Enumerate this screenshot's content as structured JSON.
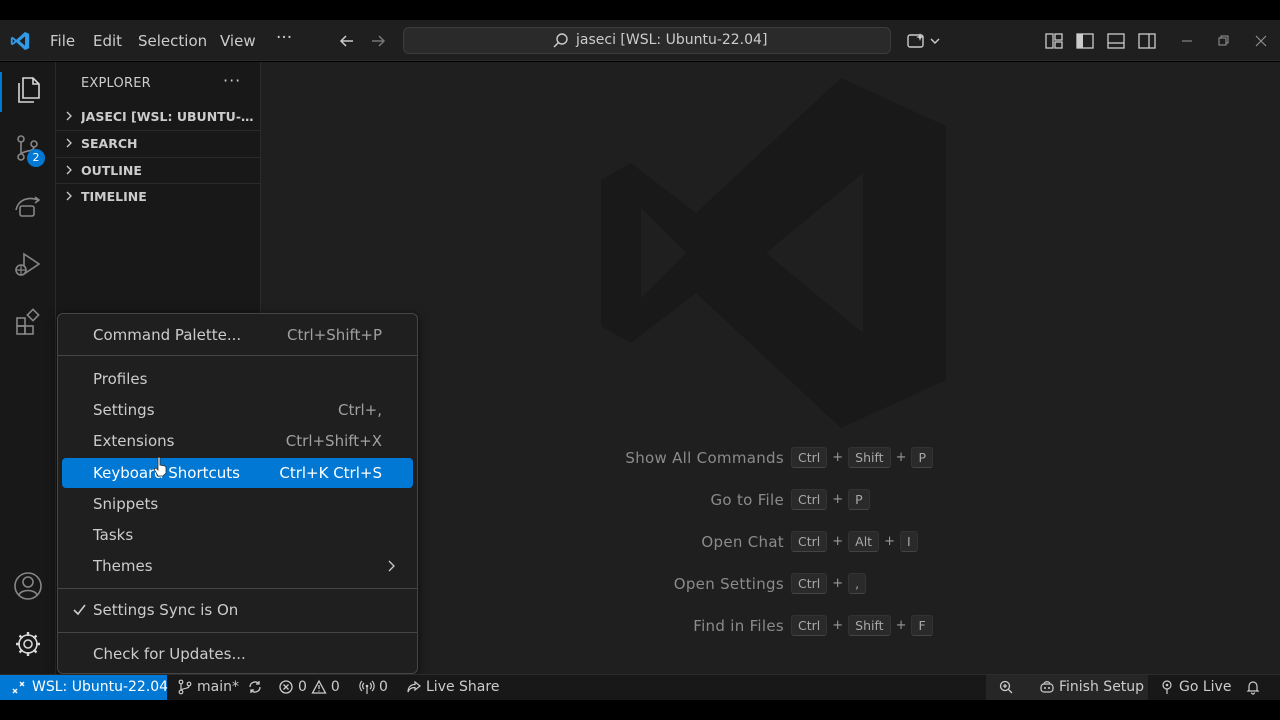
{
  "titlebar": {
    "menus": [
      "File",
      "Edit",
      "Selection",
      "View"
    ],
    "more": "···",
    "search_text": "jaseci [WSL: Ubuntu-22.04]"
  },
  "activity": {
    "source_control_badge": "2"
  },
  "sidebar": {
    "title": "EXPLORER",
    "more": "···",
    "sections": [
      "JASECI [WSL: UBUNTU-22.04]",
      "SEARCH",
      "OUTLINE",
      "TIMELINE"
    ]
  },
  "editor": {
    "hints": [
      {
        "label": "Show All Commands",
        "keys": [
          "Ctrl",
          "Shift",
          "P"
        ]
      },
      {
        "label": "Go to File",
        "keys": [
          "Ctrl",
          "P"
        ]
      },
      {
        "label": "Open Chat",
        "keys": [
          "Ctrl",
          "Alt",
          "I"
        ]
      },
      {
        "label": "Open Settings",
        "keys": [
          "Ctrl",
          ","
        ]
      },
      {
        "label": "Find in Files",
        "keys": [
          "Ctrl",
          "Shift",
          "F"
        ]
      }
    ],
    "plus": "+"
  },
  "menu": {
    "command_palette": {
      "label": "Command Palette...",
      "keys": "Ctrl+Shift+P"
    },
    "profiles": {
      "label": "Profiles"
    },
    "settings": {
      "label": "Settings",
      "keys": "Ctrl+,"
    },
    "extensions": {
      "label": "Extensions",
      "keys": "Ctrl+Shift+X"
    },
    "keyboard_shortcuts": {
      "label": "Keyboard Shortcuts",
      "keys": "Ctrl+K Ctrl+S"
    },
    "snippets": {
      "label": "Snippets"
    },
    "tasks": {
      "label": "Tasks"
    },
    "themes": {
      "label": "Themes"
    },
    "settings_sync": {
      "label": "Settings Sync is On"
    },
    "check_updates": {
      "label": "Check for Updates..."
    }
  },
  "statusbar": {
    "remote": "WSL: Ubuntu-22.04",
    "branch": "main*",
    "errors": "0",
    "warnings": "0",
    "ports": "0",
    "live_share": "Live Share",
    "finish_setup": "Finish Setup",
    "go_live": "Go Live"
  },
  "colors": {
    "accent": "#0078d4",
    "editor_bg": "#1f1f1f",
    "sidebar_bg": "#181818"
  }
}
